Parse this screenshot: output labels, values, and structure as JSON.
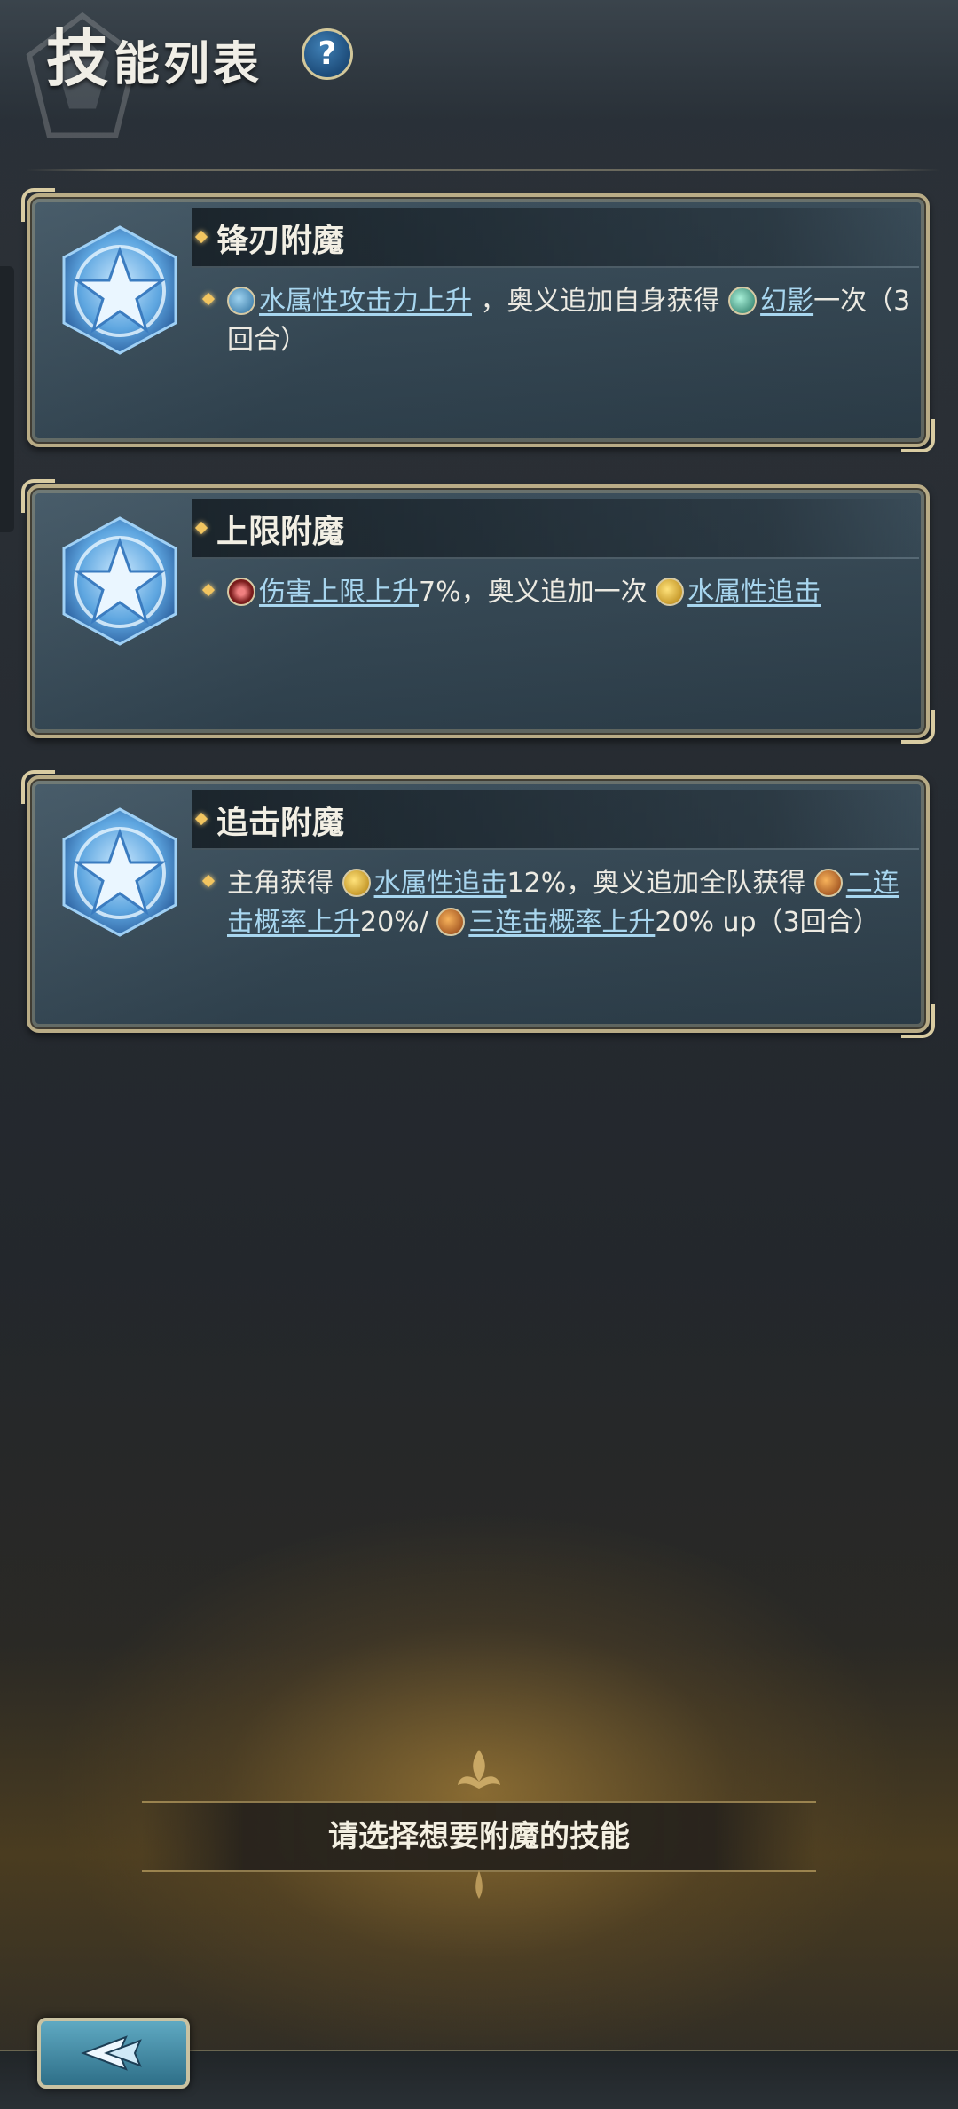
{
  "header": {
    "title_first": "技",
    "title_rest": "能列表",
    "help_label": "?"
  },
  "skills": [
    {
      "name": "锋刃附魔",
      "desc_parts": [
        {
          "type": "icon",
          "icon": "water-attack-up-icon"
        },
        {
          "type": "kw",
          "text": "水属性攻击力上升"
        },
        {
          "type": "text",
          "text": " ，奥义追加自身获得 "
        },
        {
          "type": "icon",
          "icon": "phantom-icon"
        },
        {
          "type": "kw",
          "text": "幻影"
        },
        {
          "type": "text",
          "text": "一次（3回合）"
        }
      ]
    },
    {
      "name": "上限附魔",
      "desc_parts": [
        {
          "type": "icon",
          "icon": "damage-cap-up-icon"
        },
        {
          "type": "kw",
          "text": "伤害上限上升"
        },
        {
          "type": "text",
          "text": "7%，奥义追加一次 "
        },
        {
          "type": "icon",
          "icon": "water-chase-icon"
        },
        {
          "type": "kw",
          "text": "水属性追击"
        }
      ]
    },
    {
      "name": "追击附魔",
      "desc_parts": [
        {
          "type": "text",
          "text": "主角获得 "
        },
        {
          "type": "icon",
          "icon": "water-chase-icon"
        },
        {
          "type": "kw",
          "text": "水属性追击"
        },
        {
          "type": "text",
          "text": "12%，奥义追加全队获得 "
        },
        {
          "type": "icon",
          "icon": "double-attack-up-icon"
        },
        {
          "type": "kw",
          "text": "二连击概率上升"
        },
        {
          "type": "text",
          "text": "20%/ "
        },
        {
          "type": "icon",
          "icon": "triple-attack-up-icon"
        },
        {
          "type": "kw",
          "text": "三连击概率上升"
        },
        {
          "type": "text",
          "text": "20% up（3回合）"
        }
      ]
    }
  ],
  "prompt": {
    "text": "请选择想要附魔的技能"
  },
  "back_button": {
    "icon": "back-arrow-icon"
  },
  "colors": {
    "frame_gold": "#b9ac86",
    "keyword_blue": "#a8d6ef",
    "diamond_gold": "#f2c560"
  }
}
